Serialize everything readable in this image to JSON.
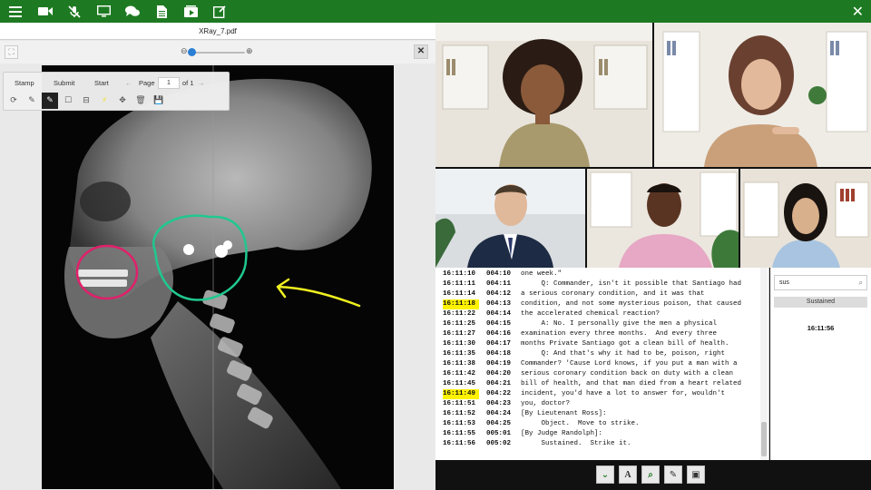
{
  "topbar": {
    "icons": [
      "menu-icon",
      "video-camera-icon",
      "mic-off-icon",
      "monitor-icon",
      "chat-icon",
      "document-icon",
      "video-file-icon",
      "note-icon"
    ],
    "close_icon": "close-icon",
    "color": "#1e7a22"
  },
  "viewer": {
    "file_title": "XRay_7.pdf",
    "toolbar": {
      "stamp": "Stamp",
      "submit": "Submit",
      "start": "Start",
      "page_label": "Page",
      "page_value": "1",
      "page_of": "of 1"
    }
  },
  "transcript": {
    "highlight_color": "#fff200",
    "lines": [
      {
        "ts": "16:11:10",
        "pg": "004:10",
        "text": "one week.\"",
        "hl": false
      },
      {
        "ts": "16:11:11",
        "pg": "004:11",
        "text": "     Q: Commander, isn't it possible that Santiago had",
        "hl": false
      },
      {
        "ts": "16:11:14",
        "pg": "004:12",
        "text": "a serious coronary condition, and it was that",
        "hl": false
      },
      {
        "ts": "16:11:18",
        "pg": "004:13",
        "text": "condition, and not some mysterious poison, that caused",
        "hl": true
      },
      {
        "ts": "16:11:22",
        "pg": "004:14",
        "text": "the accelerated chemical reaction?",
        "hl": false
      },
      {
        "ts": "16:11:25",
        "pg": "004:15",
        "text": "     A: No. I personally give the men a physical",
        "hl": false
      },
      {
        "ts": "16:11:27",
        "pg": "004:16",
        "text": "examination every three months.  And every three",
        "hl": false
      },
      {
        "ts": "16:11:30",
        "pg": "004:17",
        "text": "months Private Santiago got a clean bill of health.",
        "hl": false
      },
      {
        "ts": "16:11:35",
        "pg": "004:18",
        "text": "     Q: And that's why it had to be, poison, right",
        "hl": false
      },
      {
        "ts": "16:11:38",
        "pg": "004:19",
        "text": "Commander? 'Cause Lord knows, if you put a man with a",
        "hl": false
      },
      {
        "ts": "16:11:42",
        "pg": "004:20",
        "text": "serious coronary condition back on duty with a clean",
        "hl": false
      },
      {
        "ts": "16:11:45",
        "pg": "004:21",
        "text": "bill of health, and that man died from a heart related",
        "hl": false
      },
      {
        "ts": "16:11:49",
        "pg": "004:22",
        "text": "incident, you'd have a lot to answer for, wouldn't",
        "hl": true
      },
      {
        "ts": "16:11:51",
        "pg": "004:23",
        "text": "you, doctor?",
        "hl": false
      },
      {
        "ts": "16:11:52",
        "pg": "004:24",
        "text": "[By Lieutenant Ross]:",
        "hl": false
      },
      {
        "ts": "16:11:53",
        "pg": "004:25",
        "text": "     Object.  Move to strike.",
        "hl": false
      },
      {
        "ts": "16:11:55",
        "pg": "005:01",
        "text": "[By Judge Randolph]:",
        "hl": false
      },
      {
        "ts": "16:11:56",
        "pg": "005:02",
        "text": "     Sustained.  Strike it.",
        "hl": false
      }
    ]
  },
  "sidepanel": {
    "search_value": "sus",
    "result_label": "Sustained",
    "result_time": "16:11:56"
  },
  "bottom_buttons": [
    "double-chevron-down-icon",
    "font-icon",
    "search-icon",
    "note-icon",
    "save-icon"
  ]
}
